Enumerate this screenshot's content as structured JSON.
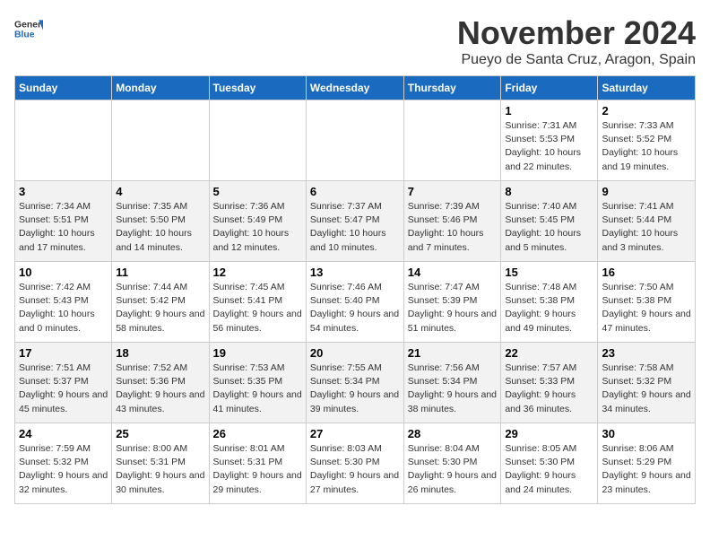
{
  "logo": {
    "general": "General",
    "blue": "Blue"
  },
  "title": "November 2024",
  "location": "Pueyo de Santa Cruz, Aragon, Spain",
  "headers": [
    "Sunday",
    "Monday",
    "Tuesday",
    "Wednesday",
    "Thursday",
    "Friday",
    "Saturday"
  ],
  "weeks": [
    [
      {
        "day": "",
        "detail": ""
      },
      {
        "day": "",
        "detail": ""
      },
      {
        "day": "",
        "detail": ""
      },
      {
        "day": "",
        "detail": ""
      },
      {
        "day": "",
        "detail": ""
      },
      {
        "day": "1",
        "detail": "Sunrise: 7:31 AM\nSunset: 5:53 PM\nDaylight: 10 hours and 22 minutes."
      },
      {
        "day": "2",
        "detail": "Sunrise: 7:33 AM\nSunset: 5:52 PM\nDaylight: 10 hours and 19 minutes."
      }
    ],
    [
      {
        "day": "3",
        "detail": "Sunrise: 7:34 AM\nSunset: 5:51 PM\nDaylight: 10 hours and 17 minutes."
      },
      {
        "day": "4",
        "detail": "Sunrise: 7:35 AM\nSunset: 5:50 PM\nDaylight: 10 hours and 14 minutes."
      },
      {
        "day": "5",
        "detail": "Sunrise: 7:36 AM\nSunset: 5:49 PM\nDaylight: 10 hours and 12 minutes."
      },
      {
        "day": "6",
        "detail": "Sunrise: 7:37 AM\nSunset: 5:47 PM\nDaylight: 10 hours and 10 minutes."
      },
      {
        "day": "7",
        "detail": "Sunrise: 7:39 AM\nSunset: 5:46 PM\nDaylight: 10 hours and 7 minutes."
      },
      {
        "day": "8",
        "detail": "Sunrise: 7:40 AM\nSunset: 5:45 PM\nDaylight: 10 hours and 5 minutes."
      },
      {
        "day": "9",
        "detail": "Sunrise: 7:41 AM\nSunset: 5:44 PM\nDaylight: 10 hours and 3 minutes."
      }
    ],
    [
      {
        "day": "10",
        "detail": "Sunrise: 7:42 AM\nSunset: 5:43 PM\nDaylight: 10 hours and 0 minutes."
      },
      {
        "day": "11",
        "detail": "Sunrise: 7:44 AM\nSunset: 5:42 PM\nDaylight: 9 hours and 58 minutes."
      },
      {
        "day": "12",
        "detail": "Sunrise: 7:45 AM\nSunset: 5:41 PM\nDaylight: 9 hours and 56 minutes."
      },
      {
        "day": "13",
        "detail": "Sunrise: 7:46 AM\nSunset: 5:40 PM\nDaylight: 9 hours and 54 minutes."
      },
      {
        "day": "14",
        "detail": "Sunrise: 7:47 AM\nSunset: 5:39 PM\nDaylight: 9 hours and 51 minutes."
      },
      {
        "day": "15",
        "detail": "Sunrise: 7:48 AM\nSunset: 5:38 PM\nDaylight: 9 hours and 49 minutes."
      },
      {
        "day": "16",
        "detail": "Sunrise: 7:50 AM\nSunset: 5:38 PM\nDaylight: 9 hours and 47 minutes."
      }
    ],
    [
      {
        "day": "17",
        "detail": "Sunrise: 7:51 AM\nSunset: 5:37 PM\nDaylight: 9 hours and 45 minutes."
      },
      {
        "day": "18",
        "detail": "Sunrise: 7:52 AM\nSunset: 5:36 PM\nDaylight: 9 hours and 43 minutes."
      },
      {
        "day": "19",
        "detail": "Sunrise: 7:53 AM\nSunset: 5:35 PM\nDaylight: 9 hours and 41 minutes."
      },
      {
        "day": "20",
        "detail": "Sunrise: 7:55 AM\nSunset: 5:34 PM\nDaylight: 9 hours and 39 minutes."
      },
      {
        "day": "21",
        "detail": "Sunrise: 7:56 AM\nSunset: 5:34 PM\nDaylight: 9 hours and 38 minutes."
      },
      {
        "day": "22",
        "detail": "Sunrise: 7:57 AM\nSunset: 5:33 PM\nDaylight: 9 hours and 36 minutes."
      },
      {
        "day": "23",
        "detail": "Sunrise: 7:58 AM\nSunset: 5:32 PM\nDaylight: 9 hours and 34 minutes."
      }
    ],
    [
      {
        "day": "24",
        "detail": "Sunrise: 7:59 AM\nSunset: 5:32 PM\nDaylight: 9 hours and 32 minutes."
      },
      {
        "day": "25",
        "detail": "Sunrise: 8:00 AM\nSunset: 5:31 PM\nDaylight: 9 hours and 30 minutes."
      },
      {
        "day": "26",
        "detail": "Sunrise: 8:01 AM\nSunset: 5:31 PM\nDaylight: 9 hours and 29 minutes."
      },
      {
        "day": "27",
        "detail": "Sunrise: 8:03 AM\nSunset: 5:30 PM\nDaylight: 9 hours and 27 minutes."
      },
      {
        "day": "28",
        "detail": "Sunrise: 8:04 AM\nSunset: 5:30 PM\nDaylight: 9 hours and 26 minutes."
      },
      {
        "day": "29",
        "detail": "Sunrise: 8:05 AM\nSunset: 5:30 PM\nDaylight: 9 hours and 24 minutes."
      },
      {
        "day": "30",
        "detail": "Sunrise: 8:06 AM\nSunset: 5:29 PM\nDaylight: 9 hours and 23 minutes."
      }
    ]
  ]
}
